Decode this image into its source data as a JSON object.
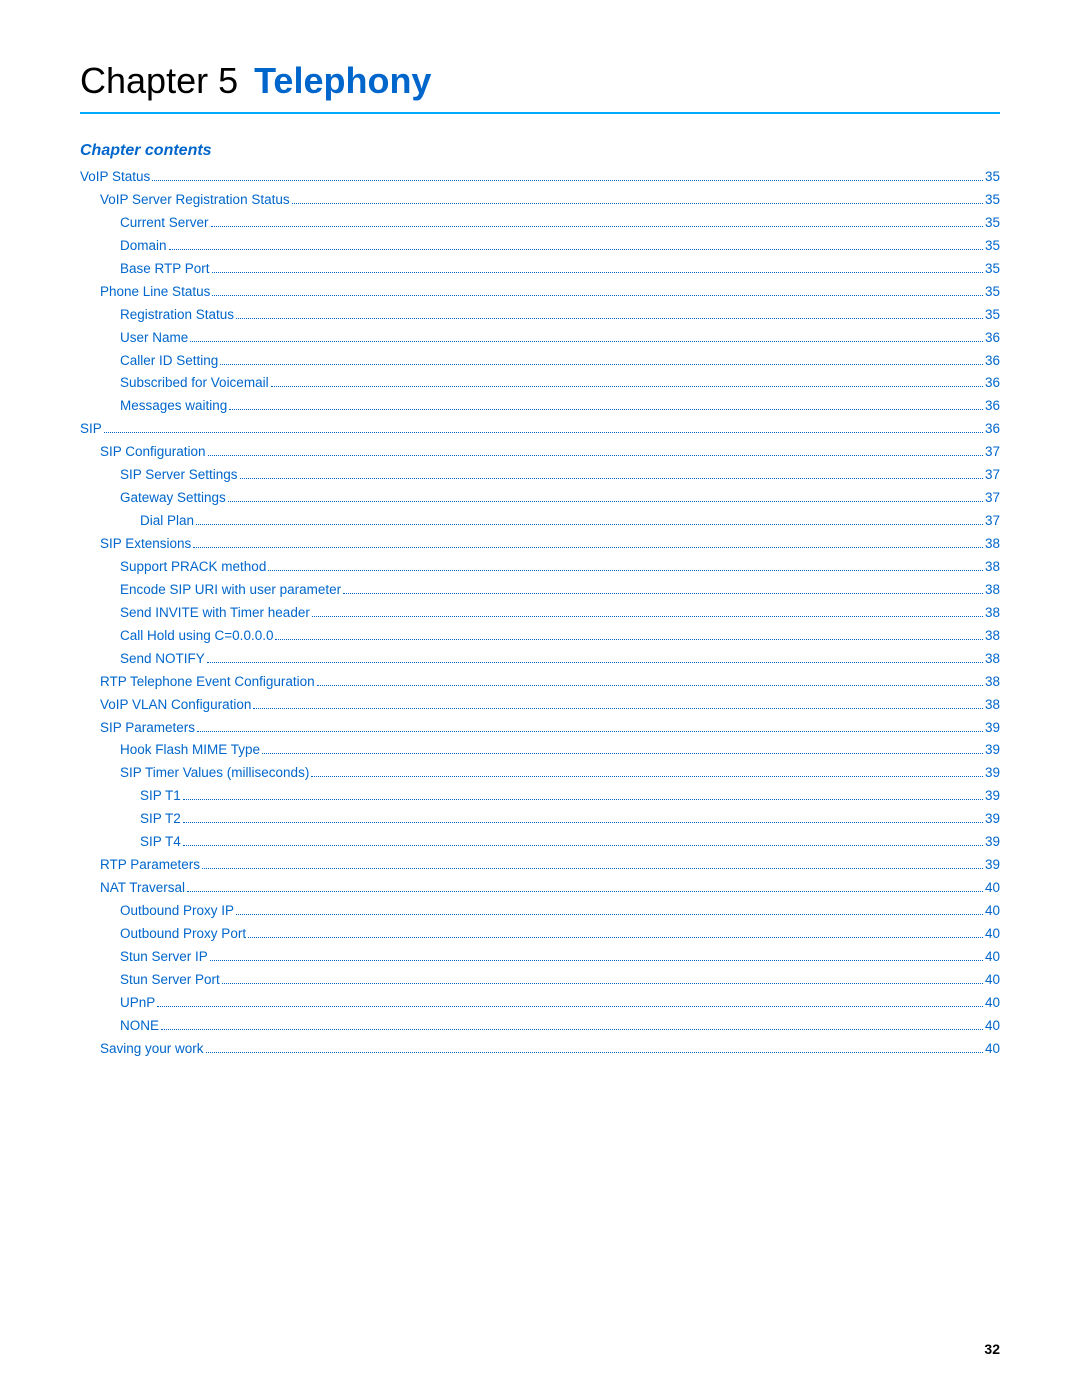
{
  "chapter": {
    "word": "Chapter 5",
    "title": "Telephony",
    "contents_label": "Chapter contents"
  },
  "toc": [
    {
      "text": "VoIP Status",
      "page": "35",
      "indent": 0
    },
    {
      "text": "VoIP Server Registration Status",
      "page": "35",
      "indent": 1
    },
    {
      "text": "Current Server",
      "page": "35",
      "indent": 2
    },
    {
      "text": "Domain",
      "page": "35",
      "indent": 2
    },
    {
      "text": "Base RTP Port",
      "page": "35",
      "indent": 2
    },
    {
      "text": "Phone Line Status",
      "page": "35",
      "indent": 1
    },
    {
      "text": "Registration Status",
      "page": "35",
      "indent": 2
    },
    {
      "text": "User Name",
      "page": "36",
      "indent": 2
    },
    {
      "text": "Caller ID Setting",
      "page": "36",
      "indent": 2
    },
    {
      "text": "Subscribed for Voicemail",
      "page": "36",
      "indent": 2
    },
    {
      "text": "Messages waiting",
      "page": "36",
      "indent": 2
    },
    {
      "text": "SIP",
      "page": "36",
      "indent": 0
    },
    {
      "text": "SIP Configuration",
      "page": "37",
      "indent": 1
    },
    {
      "text": "SIP Server Settings",
      "page": "37",
      "indent": 2
    },
    {
      "text": "Gateway Settings",
      "page": "37",
      "indent": 2
    },
    {
      "text": "Dial Plan",
      "page": "37",
      "indent": 3
    },
    {
      "text": "SIP Extensions",
      "page": "38",
      "indent": 1
    },
    {
      "text": "Support PRACK method",
      "page": "38",
      "indent": 2
    },
    {
      "text": "Encode SIP URI with user parameter",
      "page": "38",
      "indent": 2
    },
    {
      "text": "Send INVITE with Timer header",
      "page": "38",
      "indent": 2
    },
    {
      "text": "Call Hold using C=0.0.0.0",
      "page": "38",
      "indent": 2
    },
    {
      "text": "Send NOTIFY",
      "page": "38",
      "indent": 2
    },
    {
      "text": "RTP Telephone Event Configuration",
      "page": "38",
      "indent": 1
    },
    {
      "text": "VoIP VLAN Configuration",
      "page": "38",
      "indent": 1
    },
    {
      "text": "SIP Parameters",
      "page": "39",
      "indent": 1
    },
    {
      "text": "Hook Flash MIME Type",
      "page": "39",
      "indent": 2
    },
    {
      "text": "SIP Timer Values (milliseconds)",
      "page": "39",
      "indent": 2
    },
    {
      "text": "SIP T1",
      "page": "39",
      "indent": 3
    },
    {
      "text": "SIP T2",
      "page": "39",
      "indent": 3
    },
    {
      "text": "SIP T4",
      "page": "39",
      "indent": 3
    },
    {
      "text": "RTP Parameters",
      "page": "39",
      "indent": 1
    },
    {
      "text": "NAT Traversal",
      "page": "40",
      "indent": 1
    },
    {
      "text": "Outbound Proxy IP",
      "page": "40",
      "indent": 2
    },
    {
      "text": "Outbound Proxy Port",
      "page": "40",
      "indent": 2
    },
    {
      "text": "Stun Server IP",
      "page": "40",
      "indent": 2
    },
    {
      "text": "Stun Server Port",
      "page": "40",
      "indent": 2
    },
    {
      "text": "UPnP",
      "page": "40",
      "indent": 2
    },
    {
      "text": "NONE",
      "page": "40",
      "indent": 2
    },
    {
      "text": "Saving your work",
      "page": "40",
      "indent": 1
    }
  ],
  "page_number": "32"
}
